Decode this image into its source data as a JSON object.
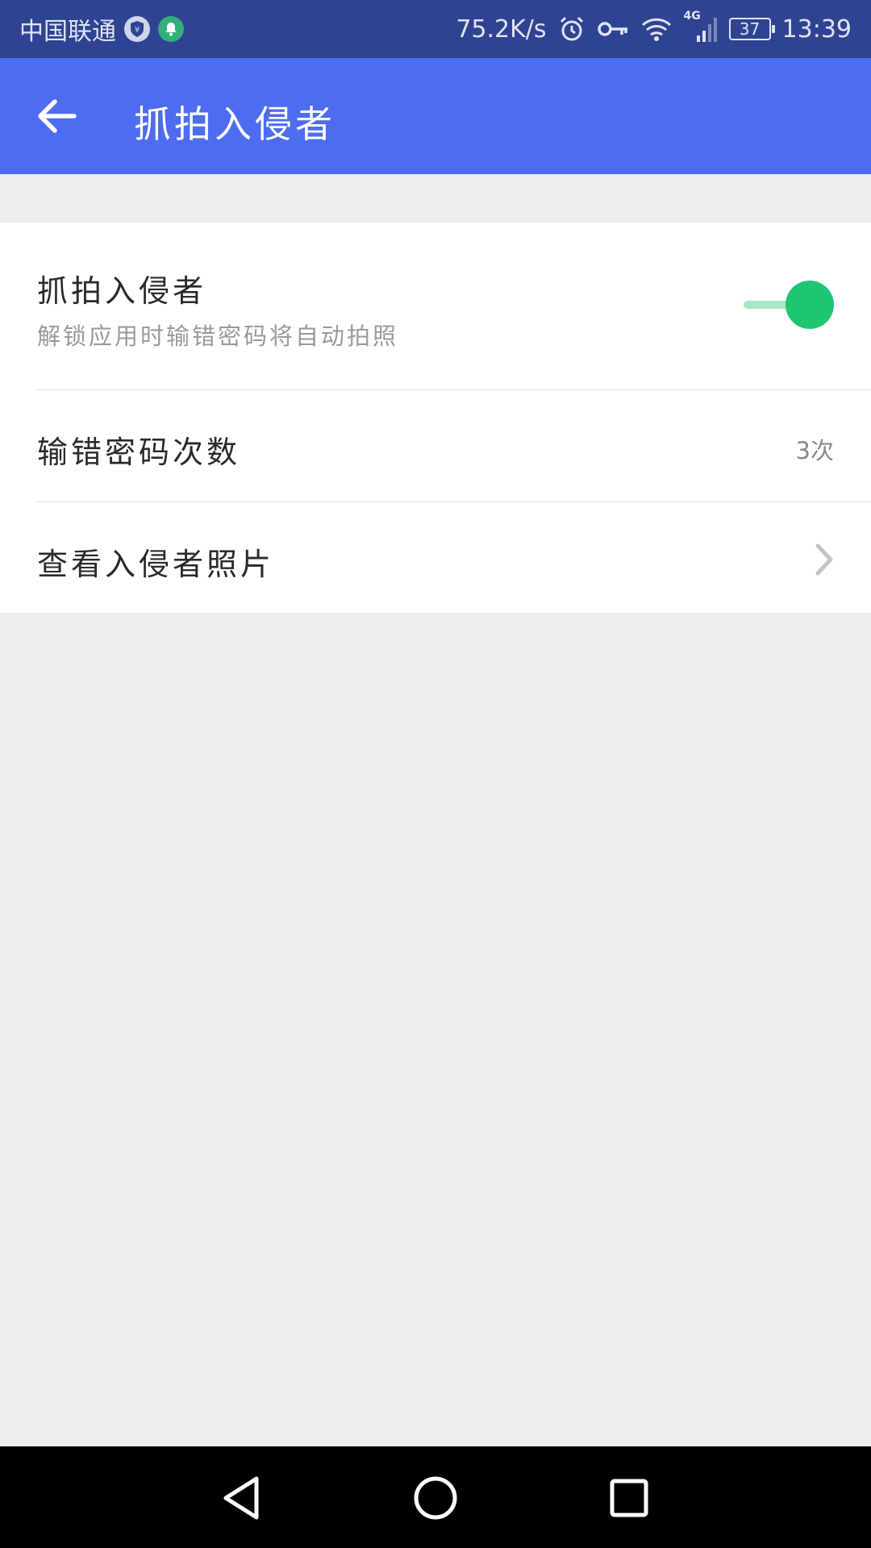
{
  "status_bar": {
    "carrier": "中国联通",
    "net_speed": "75.2K/s",
    "network_type": "4G",
    "battery": "37",
    "time": "13:39",
    "icons": [
      "shield-yuan-icon",
      "bell-icon",
      "alarm-icon",
      "key-icon",
      "wifi-icon",
      "signal-icon",
      "battery-icon"
    ]
  },
  "app_bar": {
    "title": "抓拍入侵者",
    "back_icon": "arrow-left-icon"
  },
  "settings": {
    "capture": {
      "title": "抓拍入侵者",
      "subtitle": "解锁应用时输错密码将自动拍照",
      "enabled": true
    },
    "wrong_attempts": {
      "title": "输错密码次数",
      "value": "3次"
    },
    "view_photos": {
      "title": "查看入侵者照片",
      "icon": "chevron-right-icon"
    }
  },
  "colors": {
    "status_bar": "#2f4392",
    "app_bar": "#4e6cef",
    "switch_on": "#1dc772",
    "switch_track": "#a8e6c4",
    "background": "#ededed"
  },
  "nav_bar": {
    "icons": [
      "back-triangle-icon",
      "home-circle-icon",
      "recents-square-icon"
    ]
  }
}
